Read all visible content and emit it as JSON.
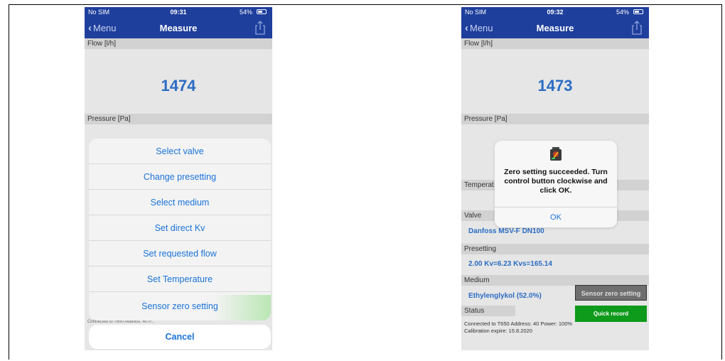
{
  "left_screen": {
    "status_bar": {
      "carrier": "No SIM",
      "time": "09:31",
      "battery": "54%"
    },
    "nav": {
      "back_label": "Menu",
      "title": "Measure"
    },
    "flow_header": "Flow [l/h]",
    "flow_value": "1474",
    "pressure_header": "Pressure [Pa]",
    "action_sheet": {
      "items": [
        "Select valve",
        "Change presetting",
        "Select medium",
        "Set direct Kv",
        "Set requested flow",
        "Set Temperature",
        "Sensor zero setting"
      ],
      "cancel_label": "Cancel"
    }
  },
  "right_screen": {
    "status_bar": {
      "carrier": "No SIM",
      "time": "09:32",
      "battery": "54%"
    },
    "nav": {
      "back_label": "Menu",
      "title": "Measure"
    },
    "flow_header": "Flow [l/h]",
    "flow_value": "1473",
    "pressure_header": "Pressure [Pa]",
    "temperature_header": "Temperat",
    "valve_header": "Valve",
    "valve_value": "Danfoss MSV-F  DN100",
    "presetting_header": "Presetting",
    "presetting_value": "2.00 Kv=6.23 Kvs=165.14",
    "medium_header": "Medium",
    "medium_value": "Ethylenglykol (52.0%)",
    "sensor_zero_label": "Sensor zero setting",
    "quick_record_label": "Quick record",
    "status_header": "Status",
    "status_text": "Connected to T650 Address: 40 Power: 100% Calibration expire: 15.8.2020",
    "alert": {
      "message": "Zero setting succeeded. Turn control button clockwise and click OK.",
      "ok_label": "OK"
    }
  },
  "colors": {
    "nav_blue": "#1e3f9c",
    "value_blue": "#2b6cc4",
    "link_blue": "#1a73d9",
    "record_green": "#0e9a1b",
    "sensor_grey": "#6f6f6f"
  },
  "icons": [
    "chevron-left-icon",
    "share-icon",
    "battery-icon",
    "wifi-icon",
    "device-warning-icon"
  ]
}
